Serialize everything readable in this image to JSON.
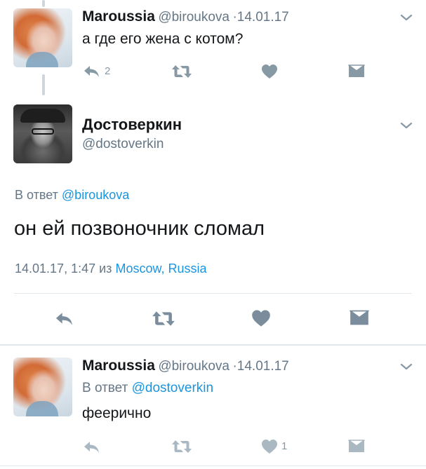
{
  "tweets": [
    {
      "name": "Maroussia",
      "handle": "@biroukova",
      "date": "14.01.17",
      "text": "а где его жена с котом?",
      "reply_count": "2"
    },
    {
      "name": "Достоверкин",
      "handle": "@dostoverkin",
      "reply_prefix": "В ответ",
      "reply_to": "@biroukova",
      "text": "он ей позвоночник сломал",
      "timestamp": "14.01.17, 1:47",
      "location_prefix": "из",
      "location": "Moscow, Russia"
    },
    {
      "name": "Maroussia",
      "handle": "@biroukova",
      "date": "14.01.17",
      "reply_prefix": "В ответ",
      "reply_to": "@dostoverkin",
      "text": "феерично",
      "like_count": "1"
    }
  ],
  "separator": "·",
  "icons": {
    "reply": "reply-icon",
    "retweet": "retweet-icon",
    "like": "heart-icon",
    "dm": "envelope-icon",
    "menu": "chevron-down-icon"
  },
  "colors": {
    "text": "#14171a",
    "secondary": "#657786",
    "link": "#1b95e0",
    "action_icon": "#8899a6",
    "divider": "#e1e8ed"
  }
}
